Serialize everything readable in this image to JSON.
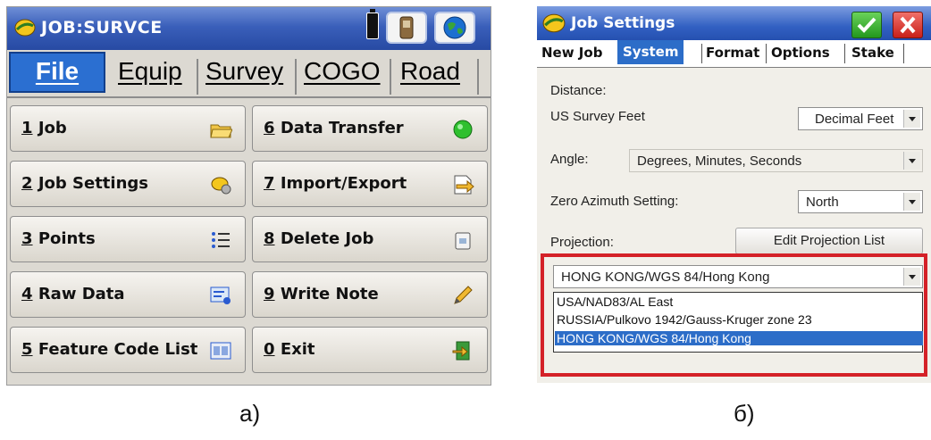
{
  "panel_a": {
    "title": "JOB:SURVCE",
    "tabs": [
      "File",
      "Equip",
      "Survey",
      "COGO",
      "Road"
    ],
    "buttons_left": [
      {
        "num": "1",
        "label": "Job"
      },
      {
        "num": "2",
        "label": "Job Settings"
      },
      {
        "num": "3",
        "label": "Points"
      },
      {
        "num": "4",
        "label": "Raw Data"
      },
      {
        "num": "5",
        "label": "Feature Code List"
      }
    ],
    "buttons_right": [
      {
        "num": "6",
        "label": "Data Transfer"
      },
      {
        "num": "7",
        "label": "Import/Export"
      },
      {
        "num": "8",
        "label": "Delete Job"
      },
      {
        "num": "9",
        "label": "Write Note"
      },
      {
        "num": "0",
        "label": "Exit"
      }
    ],
    "caption": "a)"
  },
  "panel_b": {
    "title": "Job Settings",
    "tabs": [
      "New Job",
      "System",
      "Format",
      "Options",
      "Stake"
    ],
    "distance_label": "Distance:",
    "distance_sub": "US Survey Feet",
    "distance_value": "Decimal Feet",
    "angle_label": "Angle:",
    "angle_value": "Degrees, Minutes, Seconds",
    "zero_az_label": "Zero Azimuth Setting:",
    "zero_az_value": "North",
    "projection_label": "Projection:",
    "edit_projection_button": "Edit Projection List",
    "projection_value": "HONG KONG/WGS 84/Hong Kong",
    "projection_options": [
      "USA/NAD83/AL East",
      "RUSSIA/Pulkovo 1942/Gauss-Kruger zone 23",
      "HONG KONG/WGS 84/Hong Kong"
    ],
    "caption": "б)"
  },
  "colors": {
    "titlebar_blue": "#3a5fba",
    "selected_tab": "#2b6fd1",
    "highlight_red": "#d42128"
  }
}
